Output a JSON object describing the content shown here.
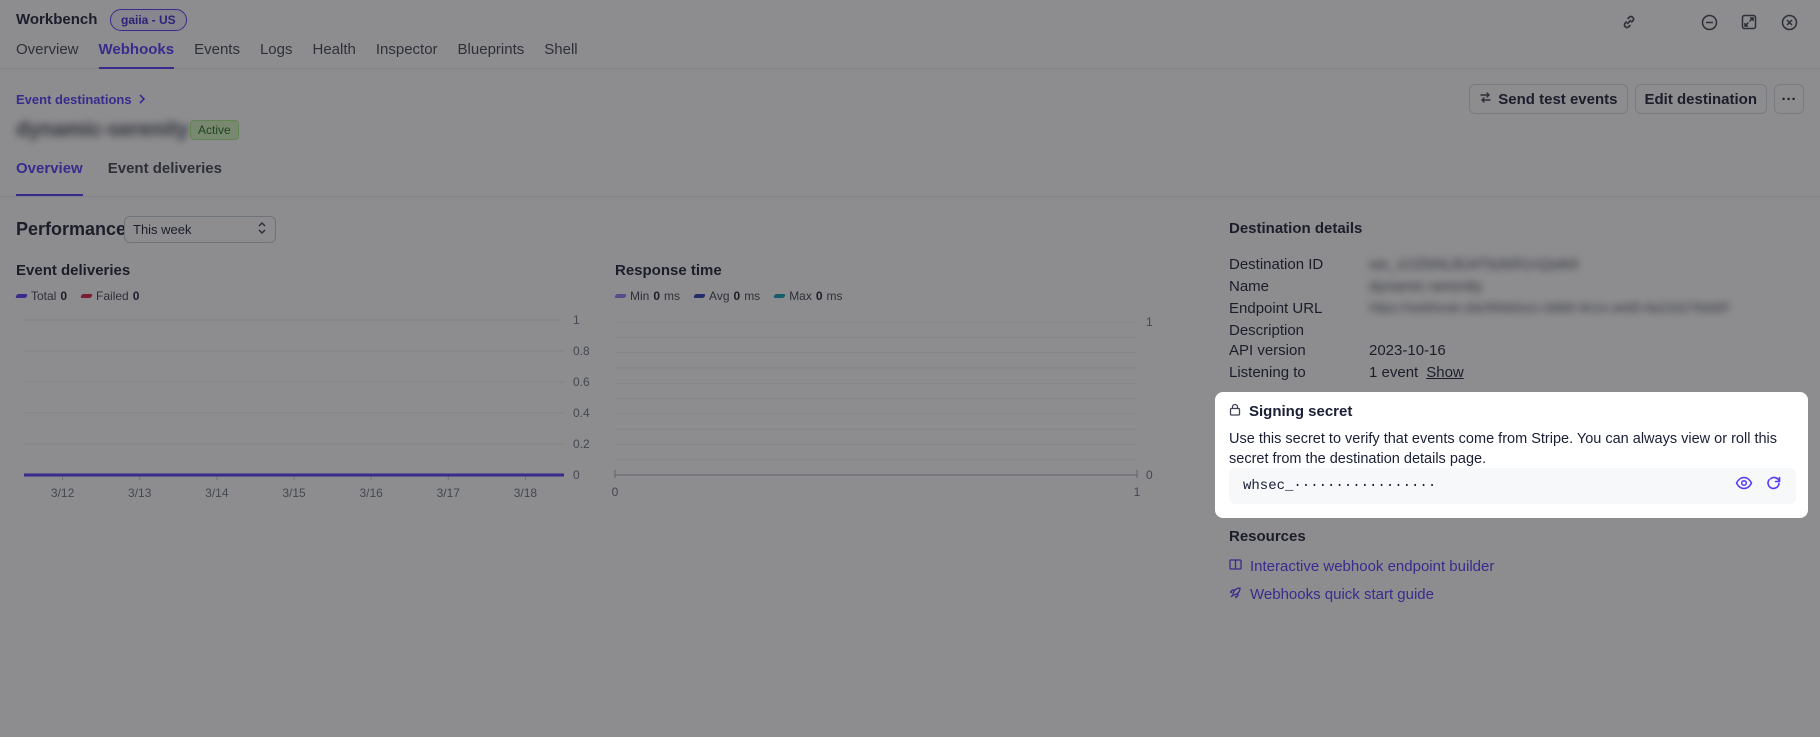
{
  "app": {
    "title": "Workbench",
    "env_badge": "gaiia - US"
  },
  "main_tabs": [
    {
      "label": "Overview"
    },
    {
      "label": "Webhooks",
      "active": true
    },
    {
      "label": "Events"
    },
    {
      "label": "Logs"
    },
    {
      "label": "Health"
    },
    {
      "label": "Inspector"
    },
    {
      "label": "Blueprints"
    },
    {
      "label": "Shell"
    }
  ],
  "breadcrumb": {
    "label": "Event destinations"
  },
  "destination": {
    "name": "dynamic-serenity",
    "status": "Active"
  },
  "header_actions": {
    "send_test": "Send test events",
    "edit": "Edit destination",
    "more": "···"
  },
  "sub_tabs": [
    {
      "label": "Overview",
      "active": true
    },
    {
      "label": "Event deliveries"
    }
  ],
  "performance": {
    "title": "Performance",
    "range": "This week"
  },
  "event_deliveries": {
    "title": "Event deliveries",
    "legend": [
      {
        "name": "Total",
        "value": "0",
        "color": "#533afd"
      },
      {
        "name": "Failed",
        "value": "0",
        "color": "#df1b41"
      }
    ]
  },
  "response_time": {
    "title": "Response time",
    "legend": [
      {
        "name": "Min",
        "value": "0",
        "unit": "ms",
        "color": "#8d7ffa"
      },
      {
        "name": "Avg",
        "value": "0",
        "unit": "ms",
        "color": "#2a43b8"
      },
      {
        "name": "Max",
        "value": "0",
        "unit": "ms",
        "color": "#0fa1b8"
      }
    ]
  },
  "chart_data": [
    {
      "type": "line",
      "title": "Event deliveries",
      "categories": [
        "3/12",
        "3/13",
        "3/14",
        "3/15",
        "3/16",
        "3/17",
        "3/18"
      ],
      "y_ticks": [
        "0",
        "0.2",
        "0.4",
        "0.6",
        "0.8",
        "1"
      ],
      "ylim": [
        0,
        1
      ],
      "series": [
        {
          "name": "Total",
          "values": [
            0,
            0,
            0,
            0,
            0,
            0,
            0
          ]
        },
        {
          "name": "Failed",
          "values": [
            0,
            0,
            0,
            0,
            0,
            0,
            0
          ]
        }
      ]
    },
    {
      "type": "line",
      "title": "Response time",
      "x_ticks": [
        "0",
        "1"
      ],
      "y_ticks": [
        "0",
        "1"
      ],
      "ylim": [
        0,
        1
      ],
      "series": [
        {
          "name": "Min",
          "values": []
        },
        {
          "name": "Avg",
          "values": []
        },
        {
          "name": "Max",
          "values": []
        }
      ]
    }
  ],
  "details": {
    "title": "Destination details",
    "rows": [
      {
        "label": "Destination ID",
        "value": "we_1OZbNLBJ4Tb2kR1nQwk9",
        "blurred": true
      },
      {
        "label": "Name",
        "value": "dynamic-serenity",
        "blurred": true
      },
      {
        "label": "Endpoint URL",
        "value": "https://webhook.site/6f4d2a1c-b9b8-4e1e-a4d5-6a21b27b6d0f",
        "blurred": true
      },
      {
        "label": "Description",
        "value": ""
      },
      {
        "label": "API version",
        "value": "2023-10-16"
      },
      {
        "label": "Listening to",
        "value": "1 event",
        "link": "Show"
      }
    ]
  },
  "signing_secret": {
    "title": "Signing secret",
    "description": "Use this secret to verify that events come from Stripe. You can always view or roll this secret from the destination details page.",
    "masked_value": "whsec_·················"
  },
  "resources": {
    "title": "Resources",
    "links": [
      {
        "label": "Interactive webhook endpoint builder",
        "icon": "book-icon"
      },
      {
        "label": "Webhooks quick start guide",
        "icon": "rocket-icon"
      }
    ]
  }
}
